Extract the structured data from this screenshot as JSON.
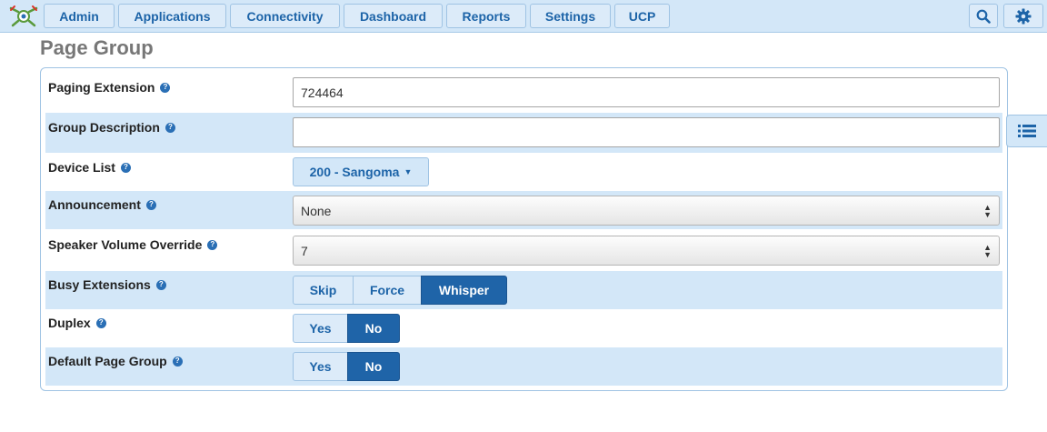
{
  "nav": {
    "items": [
      "Admin",
      "Applications",
      "Connectivity",
      "Dashboard",
      "Reports",
      "Settings",
      "UCP"
    ],
    "search_icon": "search-icon",
    "settings_icon": "gear-icon",
    "accent": "#1d64a8"
  },
  "page": {
    "title": "Page Group"
  },
  "form": {
    "paging_extension": {
      "label": "Paging Extension",
      "value": "724464"
    },
    "group_description": {
      "label": "Group Description",
      "value": ""
    },
    "device_list": {
      "label": "Device List",
      "value": "200 - Sangoma"
    },
    "announcement": {
      "label": "Announcement",
      "value": "None"
    },
    "speaker_volume": {
      "label": "Speaker Volume Override",
      "value": "7"
    },
    "busy_extensions": {
      "label": "Busy Extensions",
      "options": [
        "Skip",
        "Force",
        "Whisper"
      ],
      "selected": "Whisper"
    },
    "duplex": {
      "label": "Duplex",
      "options": [
        "Yes",
        "No"
      ],
      "selected": "No"
    },
    "default_page_group": {
      "label": "Default Page Group",
      "options": [
        "Yes",
        "No"
      ],
      "selected": "No"
    }
  },
  "help_glyph": "?",
  "side_panel_icon": "list-icon"
}
